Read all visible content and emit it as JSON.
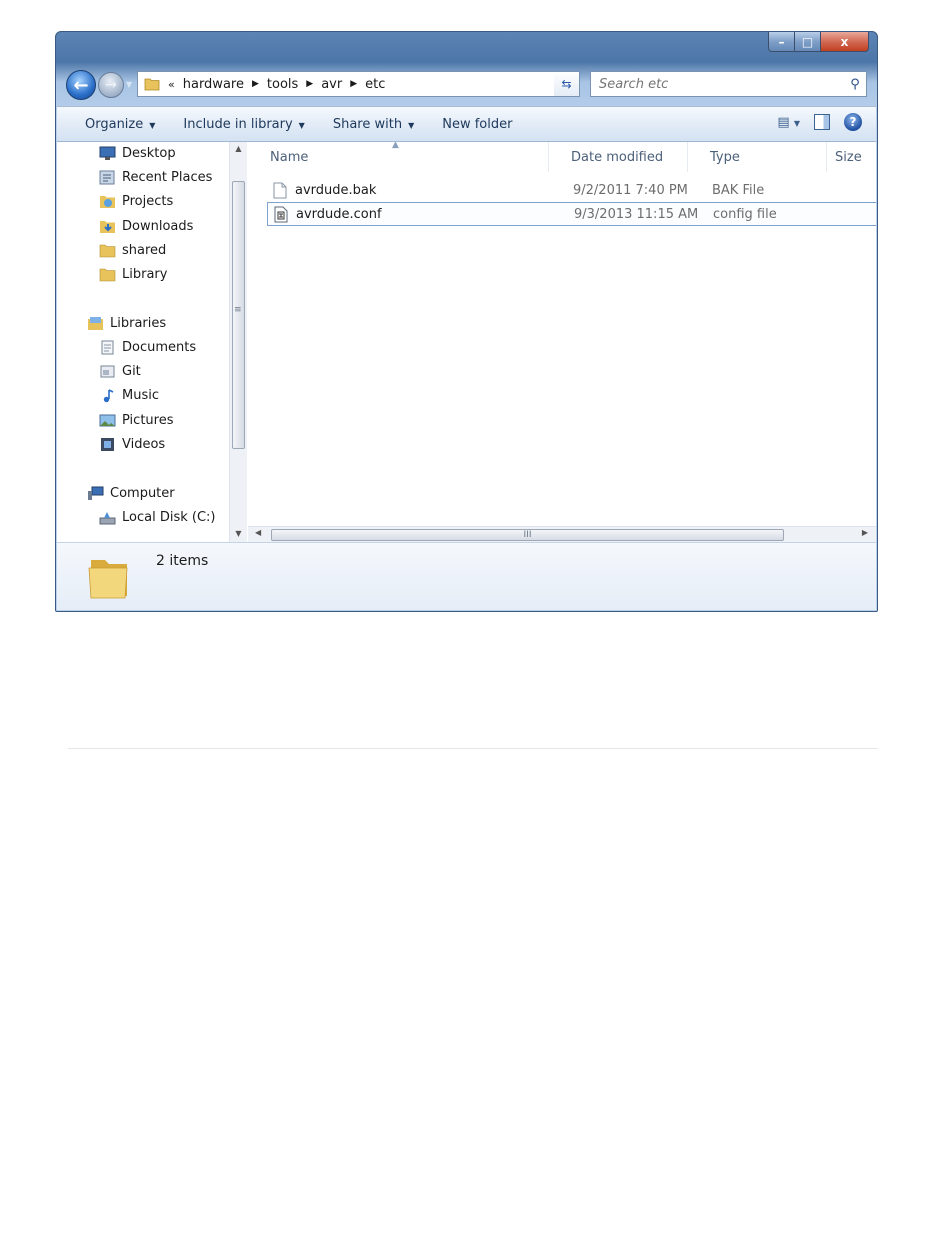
{
  "window": {
    "caption": {
      "minimize": "–",
      "maximize": "□",
      "close": "x"
    }
  },
  "nav": {
    "back_glyph": "←",
    "forward_glyph": "→",
    "address": {
      "overflow": "«",
      "crumbs": [
        "hardware",
        "tools",
        "avr",
        "etc"
      ]
    },
    "search_placeholder": "Search etc"
  },
  "toolbar": {
    "organize": "Organize",
    "include_in_library": "Include in library",
    "share_with": "Share with",
    "new_folder": "New folder"
  },
  "sidebar": {
    "favorites": [
      "Desktop",
      "Recent Places",
      "Projects",
      "Downloads",
      "shared",
      "Library"
    ],
    "libraries_label": "Libraries",
    "libraries": [
      "Documents",
      "Git",
      "Music",
      "Pictures",
      "Videos"
    ],
    "computer_label": "Computer",
    "computer": [
      "Local Disk (C:)"
    ]
  },
  "columns": [
    "Name",
    "Date modified",
    "Type",
    "Size"
  ],
  "files": [
    {
      "name": "avrdude.bak",
      "date": "9/2/2011 7:40 PM",
      "type": "BAK File"
    },
    {
      "name": "avrdude.conf",
      "date": "9/3/2013 11:15 AM",
      "type": "config file"
    }
  ],
  "status": {
    "count": "2 items"
  },
  "colors": {
    "accent": "#2a6ec9",
    "folder": "#e8c25a",
    "selection_border": "#7da2ce"
  }
}
